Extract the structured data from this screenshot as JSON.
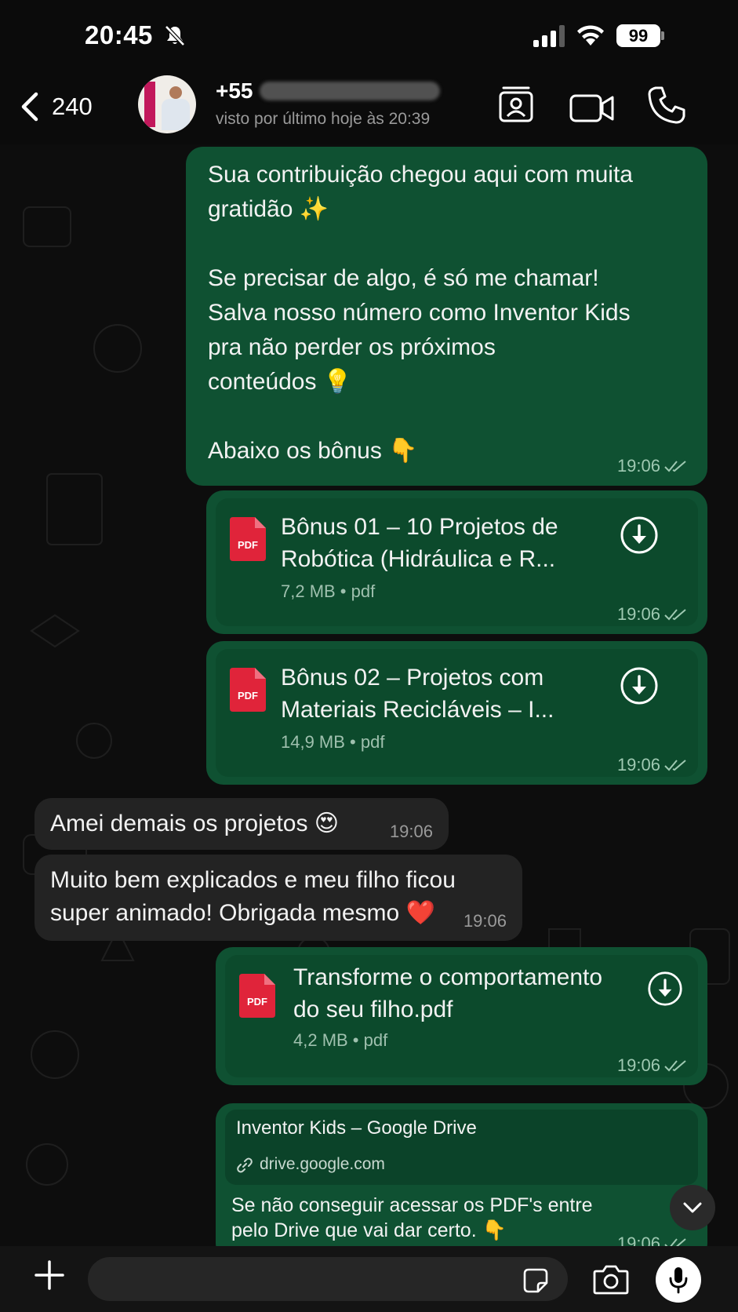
{
  "status_bar": {
    "time": "20:45",
    "battery": "99"
  },
  "header": {
    "back_count": "240",
    "contact_name": "+55",
    "contact_status": "visto por último hoje às 20:39"
  },
  "messages": [
    {
      "direction": "outgoing",
      "lines": [
        "Sua contribuição chegou aqui com muita",
        "gratidão ✨",
        "",
        "Se precisar de algo, é só me chamar!",
        "Salva nosso número como Inventor Kids",
        "pra não perder os próximos",
        "conteúdos  💡",
        "",
        "Abaixo os bônus 👇"
      ],
      "time": "19:06"
    },
    {
      "direction": "outgoing",
      "doc_icon": "PDF",
      "title_line1": "Bônus 01 – 10 Projetos de",
      "title_line2": "Robótica (Hidráulica e R...",
      "meta": "7,2 MB • pdf",
      "time": "19:06"
    },
    {
      "direction": "outgoing",
      "doc_icon": "PDF",
      "title_line1": "Bônus 02 – Projetos com",
      "title_line2": "Materiais Recicláveis – I...",
      "meta": "14,9 MB • pdf",
      "time": "19:06"
    },
    {
      "direction": "incoming",
      "text": "Amei demais os projetos 😍",
      "time": "19:06"
    },
    {
      "direction": "incoming",
      "line1": "Muito bem explicados e meu filho ficou",
      "line2": "super animado! Obrigada mesmo ❤️",
      "time": "19:06"
    },
    {
      "direction": "outgoing",
      "doc_icon": "PDF",
      "title_line1": "Transforme o comportamento",
      "title_line2": "do seu filho.pdf",
      "meta": "4,2 MB • pdf",
      "time": "19:06"
    },
    {
      "direction": "outgoing",
      "link_title": "Inventor Kids – Google Drive",
      "link_url": "drive.google.com",
      "line1": "Se não conseguir acessar os PDF's entre",
      "line2": "pelo Drive que vai dar certo. 👇",
      "time": "19:06"
    }
  ],
  "input": {
    "placeholder": ""
  },
  "colors": {
    "outgoing_bubble": "#0f5132",
    "incoming_bubble": "#232323",
    "background": "#0b0b0b"
  }
}
